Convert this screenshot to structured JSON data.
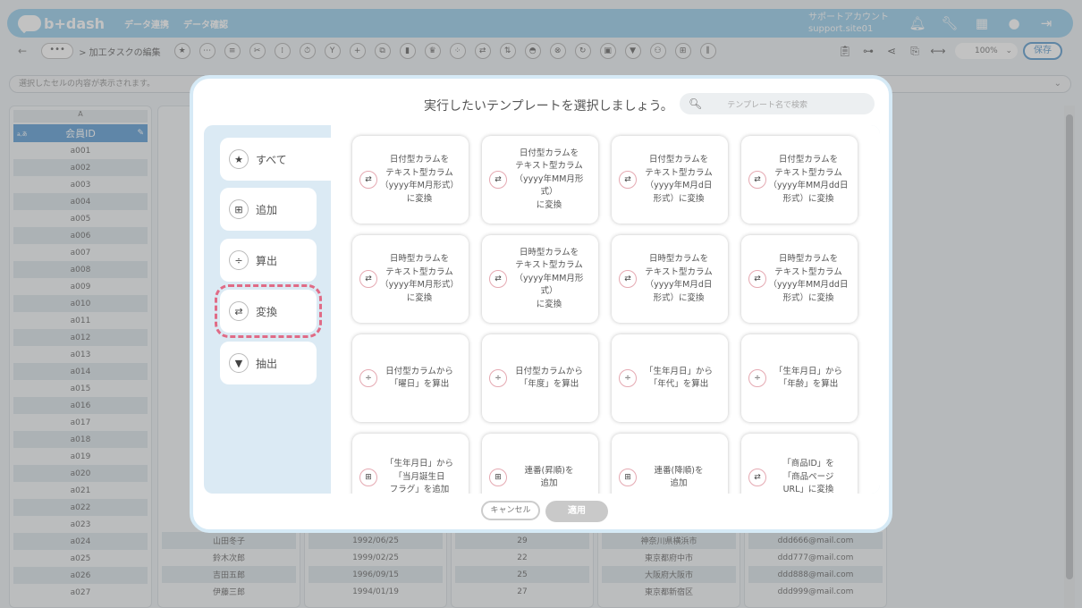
{
  "header": {
    "logo": "b+dash",
    "nav": [
      "データ連携",
      "データ確認"
    ],
    "account_label": "サポートアカウント",
    "account_id": "support.site01"
  },
  "toolbar": {
    "breadcrumb": "> 加工タスクの編集",
    "zoom": "100%",
    "save_label": "保存",
    "dots": "•••"
  },
  "cellbar": {
    "placeholder": "選択したセルの内容が表示されます。"
  },
  "grid": {
    "col_letter": "A",
    "col_header": "会員ID",
    "col_tag": "a,あ",
    "ids": [
      "a001",
      "a002",
      "a003",
      "a004",
      "a005",
      "a006",
      "a007",
      "a008",
      "a009",
      "a010",
      "a011",
      "a012",
      "a013",
      "a014",
      "a015",
      "a016",
      "a017",
      "a018",
      "a019",
      "a020",
      "a021",
      "a022",
      "a023",
      "a024",
      "a025",
      "a026",
      "a027"
    ],
    "rows_visible": [
      {
        "name": "山田冬子",
        "date": "1992/06/25",
        "age": "29",
        "city": "神奈川県横浜市",
        "email": "ddd666@mail.com"
      },
      {
        "name": "鈴木次郎",
        "date": "1999/02/25",
        "age": "22",
        "city": "東京都府中市",
        "email": "ddd777@mail.com"
      },
      {
        "name": "吉田五郎",
        "date": "1996/09/15",
        "age": "25",
        "city": "大阪府大阪市",
        "email": "ddd888@mail.com"
      },
      {
        "name": "伊藤三郎",
        "date": "1994/01/19",
        "age": "27",
        "city": "東京都新宿区",
        "email": "ddd999@mail.com"
      }
    ]
  },
  "modal": {
    "title": "実行したいテンプレートを選択しましょう。",
    "search_placeholder": "テンプレート名で検索",
    "cancel_label": "キャンセル",
    "apply_label": "適用",
    "categories": [
      {
        "label": "すべて",
        "icon": "★"
      },
      {
        "label": "追加",
        "icon": "⊞"
      },
      {
        "label": "算出",
        "icon": "÷"
      },
      {
        "label": "変換",
        "icon": "⇄"
      },
      {
        "label": "抽出",
        "icon": "▼"
      }
    ],
    "cards": [
      {
        "text": "日付型カラムを\nテキスト型カラム\n（yyyy年M月形式）\nに変換",
        "icon": "⇄"
      },
      {
        "text": "日付型カラムを\nテキスト型カラム\n（yyyy年MM月形式）\nに変換",
        "icon": "⇄"
      },
      {
        "text": "日付型カラムを\nテキスト型カラム\n（yyyy年M月d日\n形式）に変換",
        "icon": "⇄"
      },
      {
        "text": "日付型カラムを\nテキスト型カラム\n（yyyy年MM月dd日\n形式）に変換",
        "icon": "⇄"
      },
      {
        "text": "日時型カラムを\nテキスト型カラム\n（yyyy年M月形式）\nに変換",
        "icon": "⇄"
      },
      {
        "text": "日時型カラムを\nテキスト型カラム\n（yyyy年MM月形式）\nに変換",
        "icon": "⇄"
      },
      {
        "text": "日時型カラムを\nテキスト型カラム\n（yyyy年M月d日\n形式）に変換",
        "icon": "⇄"
      },
      {
        "text": "日時型カラムを\nテキスト型カラム\n（yyyy年MM月dd日\n形式）に変換",
        "icon": "⇄"
      },
      {
        "text": "日付型カラムから\n「曜日」を算出",
        "icon": "÷"
      },
      {
        "text": "日付型カラムから\n「年度」を算出",
        "icon": "÷"
      },
      {
        "text": "「生年月日」から\n「年代」を算出",
        "icon": "÷"
      },
      {
        "text": "「生年月日」から\n「年齢」を算出",
        "icon": "÷"
      },
      {
        "text": "「生年月日」から\n「当月誕生日\nフラグ」を追加",
        "icon": "⊞"
      },
      {
        "text": "連番(昇順)を\n追加",
        "icon": "⊞"
      },
      {
        "text": "連番(降順)を\n追加",
        "icon": "⊞"
      },
      {
        "text": "「商品ID」を\n「商品ページ\nURL」に変換",
        "icon": "⇄"
      }
    ]
  }
}
